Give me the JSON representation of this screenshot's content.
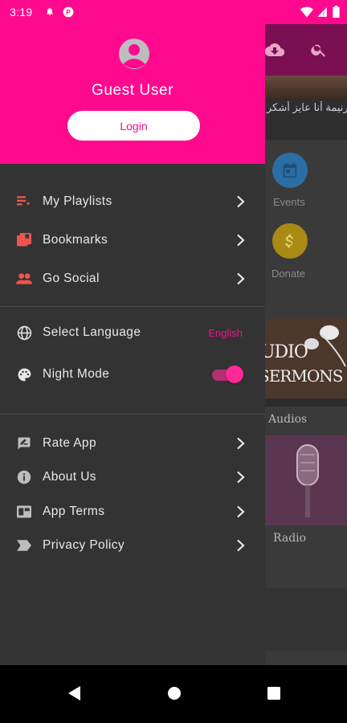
{
  "status_bar": {
    "time": "3:19",
    "icons": [
      "notification-bell-icon",
      "app-notification-icon",
      "wifi-icon",
      "signal-icon",
      "battery-icon"
    ]
  },
  "drawer": {
    "header": {
      "user_name": "Guest User",
      "login_label": "Login",
      "avatar_icon": "account-circle-icon"
    },
    "sections": {
      "main": [
        {
          "label": "My Playlists",
          "icon": "playlist-icon",
          "icon_color": "#ef5350"
        },
        {
          "label": "Bookmarks",
          "icon": "bookmarks-icon",
          "icon_color": "#ef5350"
        },
        {
          "label": "Go Social",
          "icon": "people-icon",
          "icon_color": "#ef5350"
        }
      ],
      "settings": {
        "language_label": "Select Language",
        "language_value": "English",
        "night_mode_label": "Night Mode",
        "night_mode_on": true
      },
      "about": [
        {
          "label": "Rate App",
          "icon": "rate-review-icon"
        },
        {
          "label": "About Us",
          "icon": "info-icon"
        },
        {
          "label": "App Terms",
          "icon": "terms-icon"
        },
        {
          "label": "Privacy Policy",
          "icon": "label-tag-icon"
        }
      ]
    }
  },
  "background": {
    "hero_caption": "ترنيمة أنا عايز أشكر",
    "events_label": "Events",
    "donate_label": "Donate",
    "audios_label": "Audios",
    "radio_label": "Radio",
    "audio_tile_text_line1": "UDIO",
    "audio_tile_text_line2": "SERMONS"
  },
  "colors": {
    "accent": "#ff0a8e",
    "drawer_bg": "#333333",
    "menu_text": "#e8e8e8",
    "menu_icon_red": "#ef5350",
    "menu_icon_gray": "#bdbdbd"
  }
}
